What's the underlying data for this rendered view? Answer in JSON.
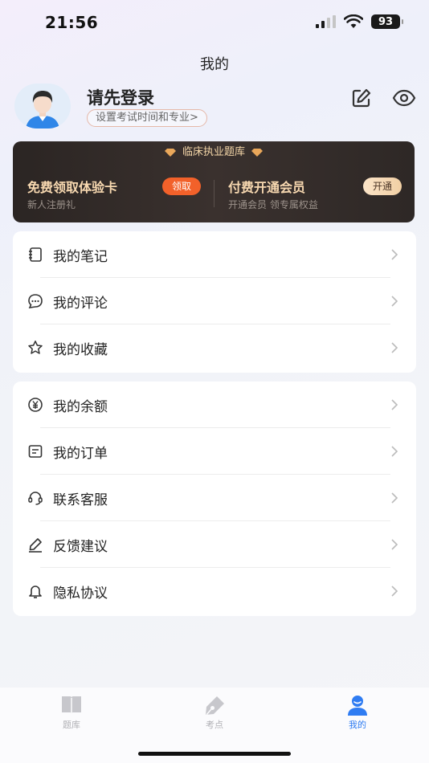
{
  "status_bar": {
    "time": "21:56",
    "battery": "93"
  },
  "nav": {
    "title": "我的"
  },
  "profile": {
    "login_prompt": "请先登录",
    "exam_setting": "设置考试时间和专业>"
  },
  "vip": {
    "header": "临床执业题库",
    "trial": {
      "title": "免费领取体验卡",
      "subtitle": "新人注册礼",
      "button": "领取"
    },
    "member": {
      "title": "付费开通会员",
      "subtitle": "开通会员 领专属权益",
      "button": "开通"
    }
  },
  "menu_group_1": [
    {
      "label": "我的笔记",
      "icon": "notebook-icon"
    },
    {
      "label": "我的评论",
      "icon": "comment-icon"
    },
    {
      "label": "我的收藏",
      "icon": "star-icon"
    }
  ],
  "menu_group_2": [
    {
      "label": "我的余额",
      "icon": "yen-coin-icon"
    },
    {
      "label": "我的订单",
      "icon": "order-icon"
    },
    {
      "label": "联系客服",
      "icon": "headset-icon"
    },
    {
      "label": "反馈建议",
      "icon": "pen-icon"
    },
    {
      "label": "隐私协议",
      "icon": "bell-icon"
    }
  ],
  "tabs": [
    {
      "label": "题库",
      "icon": "book-icon",
      "active": false
    },
    {
      "label": "考点",
      "icon": "pen-nib-icon",
      "active": false
    },
    {
      "label": "我的",
      "icon": "user-icon",
      "active": true
    }
  ],
  "colors": {
    "accent": "#2f7cf2",
    "claim": "#f2612a",
    "vip_gold": "#f7d8b0",
    "vip_bg": "#2b2523"
  }
}
